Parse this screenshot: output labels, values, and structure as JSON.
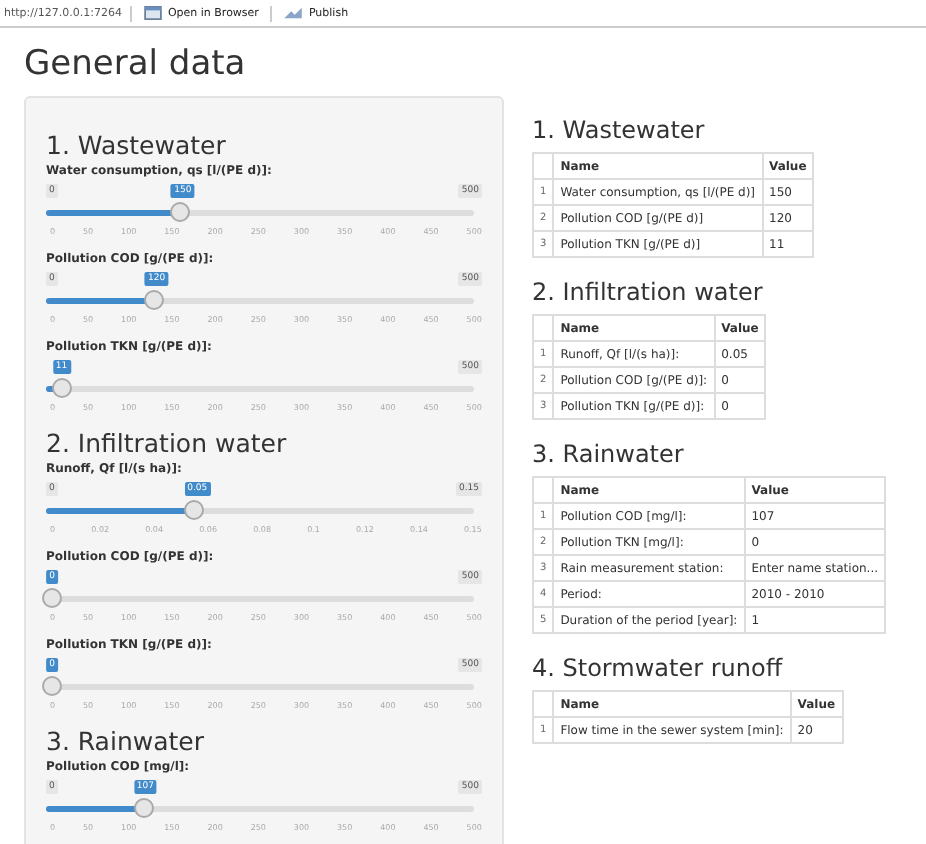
{
  "toolbar": {
    "url": "http://127.0.0.1:7264",
    "buttons": [
      {
        "kind": "browser",
        "label": "Open in Browser"
      },
      {
        "kind": "publish",
        "label": "Publish"
      }
    ]
  },
  "title": "General data",
  "input_sections": [
    {
      "heading": "1. Wastewater",
      "sliders": [
        {
          "label": "Water consumption, qs [l/(PE d)]:",
          "min": "0",
          "max": "500",
          "value": "150",
          "level": 0.3,
          "ticks": [
            "0",
            "50",
            "100",
            "150",
            "200",
            "250",
            "300",
            "350",
            "400",
            "450",
            "500"
          ]
        },
        {
          "label": "Pollution COD [g/(PE d)]:",
          "min": "0",
          "max": "500",
          "value": "120",
          "level": 0.24,
          "ticks": [
            "0",
            "50",
            "100",
            "150",
            "200",
            "250",
            "300",
            "350",
            "400",
            "450",
            "500"
          ]
        },
        {
          "label": "Pollution TKN [g/(PE d)]:",
          "max": "500",
          "value": "11",
          "level": 0.022,
          "ticks": [
            "0",
            "50",
            "100",
            "150",
            "200",
            "250",
            "300",
            "350",
            "400",
            "450",
            "500"
          ]
        }
      ]
    },
    {
      "heading": "2. Infiltration water",
      "sliders": [
        {
          "label": "Runoff, Qf [l/(s ha)]:",
          "min": "0",
          "max": "0.15",
          "value": "0.05",
          "level": 0.333,
          "ticks": [
            "0",
            "0.02",
            "0.04",
            "0.06",
            "0.08",
            "0.1",
            "0.12",
            "0.14",
            "0.15"
          ]
        },
        {
          "label": "Pollution COD [g/(PE d)]:",
          "max": "500",
          "value": "0",
          "level": 0,
          "ticks": [
            "0",
            "50",
            "100",
            "150",
            "200",
            "250",
            "300",
            "350",
            "400",
            "450",
            "500"
          ]
        },
        {
          "label": "Pollution TKN [g/(PE d)]:",
          "max": "500",
          "value": "0",
          "level": 0,
          "ticks": [
            "0",
            "50",
            "100",
            "150",
            "200",
            "250",
            "300",
            "350",
            "400",
            "450",
            "500"
          ]
        }
      ]
    },
    {
      "heading": "3. Rainwater",
      "sliders": [
        {
          "label": "Pollution COD [mg/l]:",
          "min": "0",
          "max": "500",
          "value": "107",
          "level": 0.214,
          "ticks": [
            "0",
            "50",
            "100",
            "150",
            "200",
            "250",
            "300",
            "350",
            "400",
            "450",
            "500"
          ]
        }
      ]
    }
  ],
  "summary_tables": [
    {
      "heading": "1. Wastewater",
      "columns": [
        "",
        "Name",
        "Value"
      ],
      "rows": [
        [
          "1",
          "Water consumption, qs [l/(PE d)]",
          "150"
        ],
        [
          "2",
          "Pollution COD [g/(PE d)]",
          "120"
        ],
        [
          "3",
          "Pollution TKN [g/(PE d)]",
          "11"
        ]
      ]
    },
    {
      "heading": "2. Infiltration water",
      "columns": [
        "",
        "Name",
        "Value"
      ],
      "rows": [
        [
          "1",
          "Runoff, Qf [l/(s ha)]:",
          "0.05"
        ],
        [
          "2",
          "Pollution COD [g/(PE d)]:",
          "0"
        ],
        [
          "3",
          "Pollution TKN [g/(PE d)]:",
          "0"
        ]
      ]
    },
    {
      "heading": "3. Rainwater",
      "columns": [
        "",
        "Name",
        "Value"
      ],
      "rows": [
        [
          "1",
          "Pollution COD [mg/l]:",
          "107"
        ],
        [
          "2",
          "Pollution TKN [mg/l]:",
          "0"
        ],
        [
          "3",
          "Rain measurement station:",
          "Enter name station..."
        ],
        [
          "4",
          "Period:",
          "2010 - 2010"
        ],
        [
          "5",
          "Duration of the period [year]:",
          "1"
        ]
      ]
    },
    {
      "heading": "4. Stormwater runoff",
      "columns": [
        "",
        "Name",
        "Value"
      ],
      "rows": [
        [
          "1",
          "Flow time in the sewer system [min]:",
          "20"
        ]
      ]
    }
  ]
}
